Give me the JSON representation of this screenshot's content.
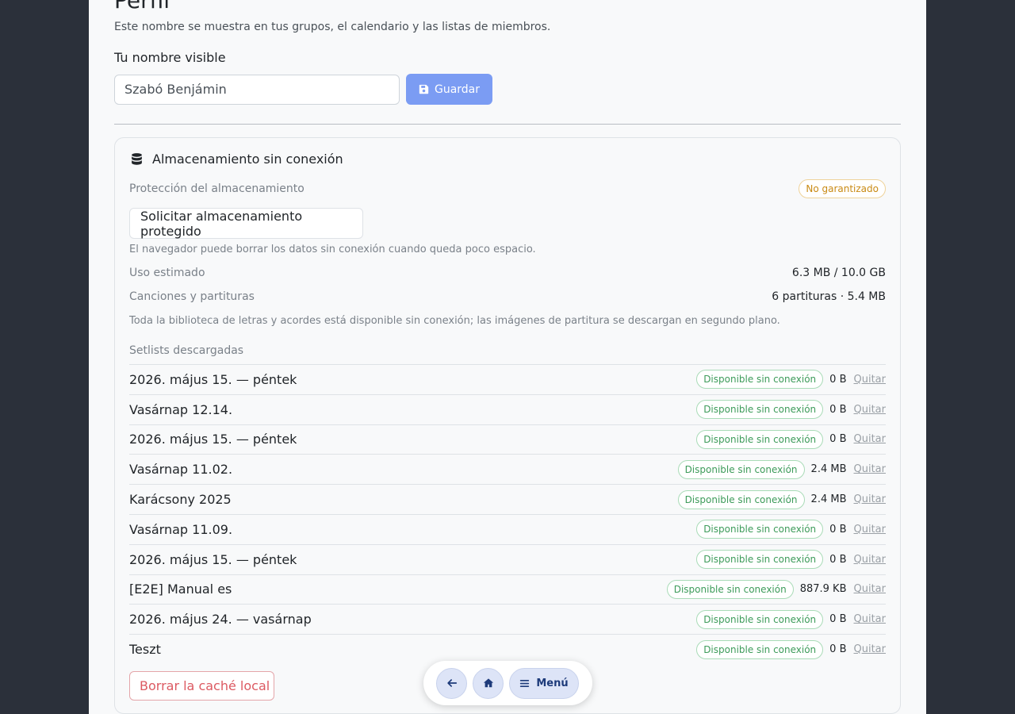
{
  "profile": {
    "title": "Perfil",
    "subtitle": "Este nombre se muestra en tus grupos, el calendario y las listas de miembros.",
    "name_label": "Tu nombre visible",
    "name_value": "Szabó Benjámin",
    "save_label": "Guardar"
  },
  "storage": {
    "title": "Almacenamiento sin conexión",
    "protection_label": "Protección del almacenamiento",
    "protection_badge": "No garantizado",
    "protect_button": "Solicitar almacenamiento protegido",
    "protect_note": "El navegador puede borrar los datos sin conexión cuando queda poco espacio.",
    "usage_label": "Uso estimado",
    "usage_value": "6.3 MB / 10.0 GB",
    "songs_label": "Canciones y partituras",
    "songs_value": "6 partituras · 5.4 MB",
    "library_note": "Toda la biblioteca de letras y acordes está disponible sin conexión; las imágenes de partitura se descargan en segundo plano.",
    "setlists_label": "Setlists descargadas",
    "clear_button": "Borrar la caché local",
    "setlists": [
      {
        "name": "2026. május 15. — péntek",
        "status": "Disponible sin conexión",
        "size": "0 B",
        "action": "Quitar"
      },
      {
        "name": "Vasárnap 12.14.",
        "status": "Disponible sin conexión",
        "size": "0 B",
        "action": "Quitar"
      },
      {
        "name": "2026. május 15. — péntek",
        "status": "Disponible sin conexión",
        "size": "0 B",
        "action": "Quitar"
      },
      {
        "name": "Vasárnap 11.02.",
        "status": "Disponible sin conexión",
        "size": "2.4 MB",
        "action": "Quitar"
      },
      {
        "name": "Karácsony 2025",
        "status": "Disponible sin conexión",
        "size": "2.4 MB",
        "action": "Quitar"
      },
      {
        "name": "Vasárnap 11.09.",
        "status": "Disponible sin conexión",
        "size": "0 B",
        "action": "Quitar"
      },
      {
        "name": "2026. május 15. — péntek",
        "status": "Disponible sin conexión",
        "size": "0 B",
        "action": "Quitar"
      },
      {
        "name": "[E2E] Manual es",
        "status": "Disponible sin conexión",
        "size": "887.9 KB",
        "action": "Quitar"
      },
      {
        "name": "2026. május 24. — vasárnap",
        "status": "Disponible sin conexión",
        "size": "0 B",
        "action": "Quitar"
      },
      {
        "name": "Teszt",
        "status": "Disponible sin conexión",
        "size": "0 B",
        "action": "Quitar"
      }
    ]
  },
  "bottom_nav": {
    "back_icon": "arrow-left-icon",
    "home_icon": "home-icon",
    "menu_label": "Menú"
  }
}
